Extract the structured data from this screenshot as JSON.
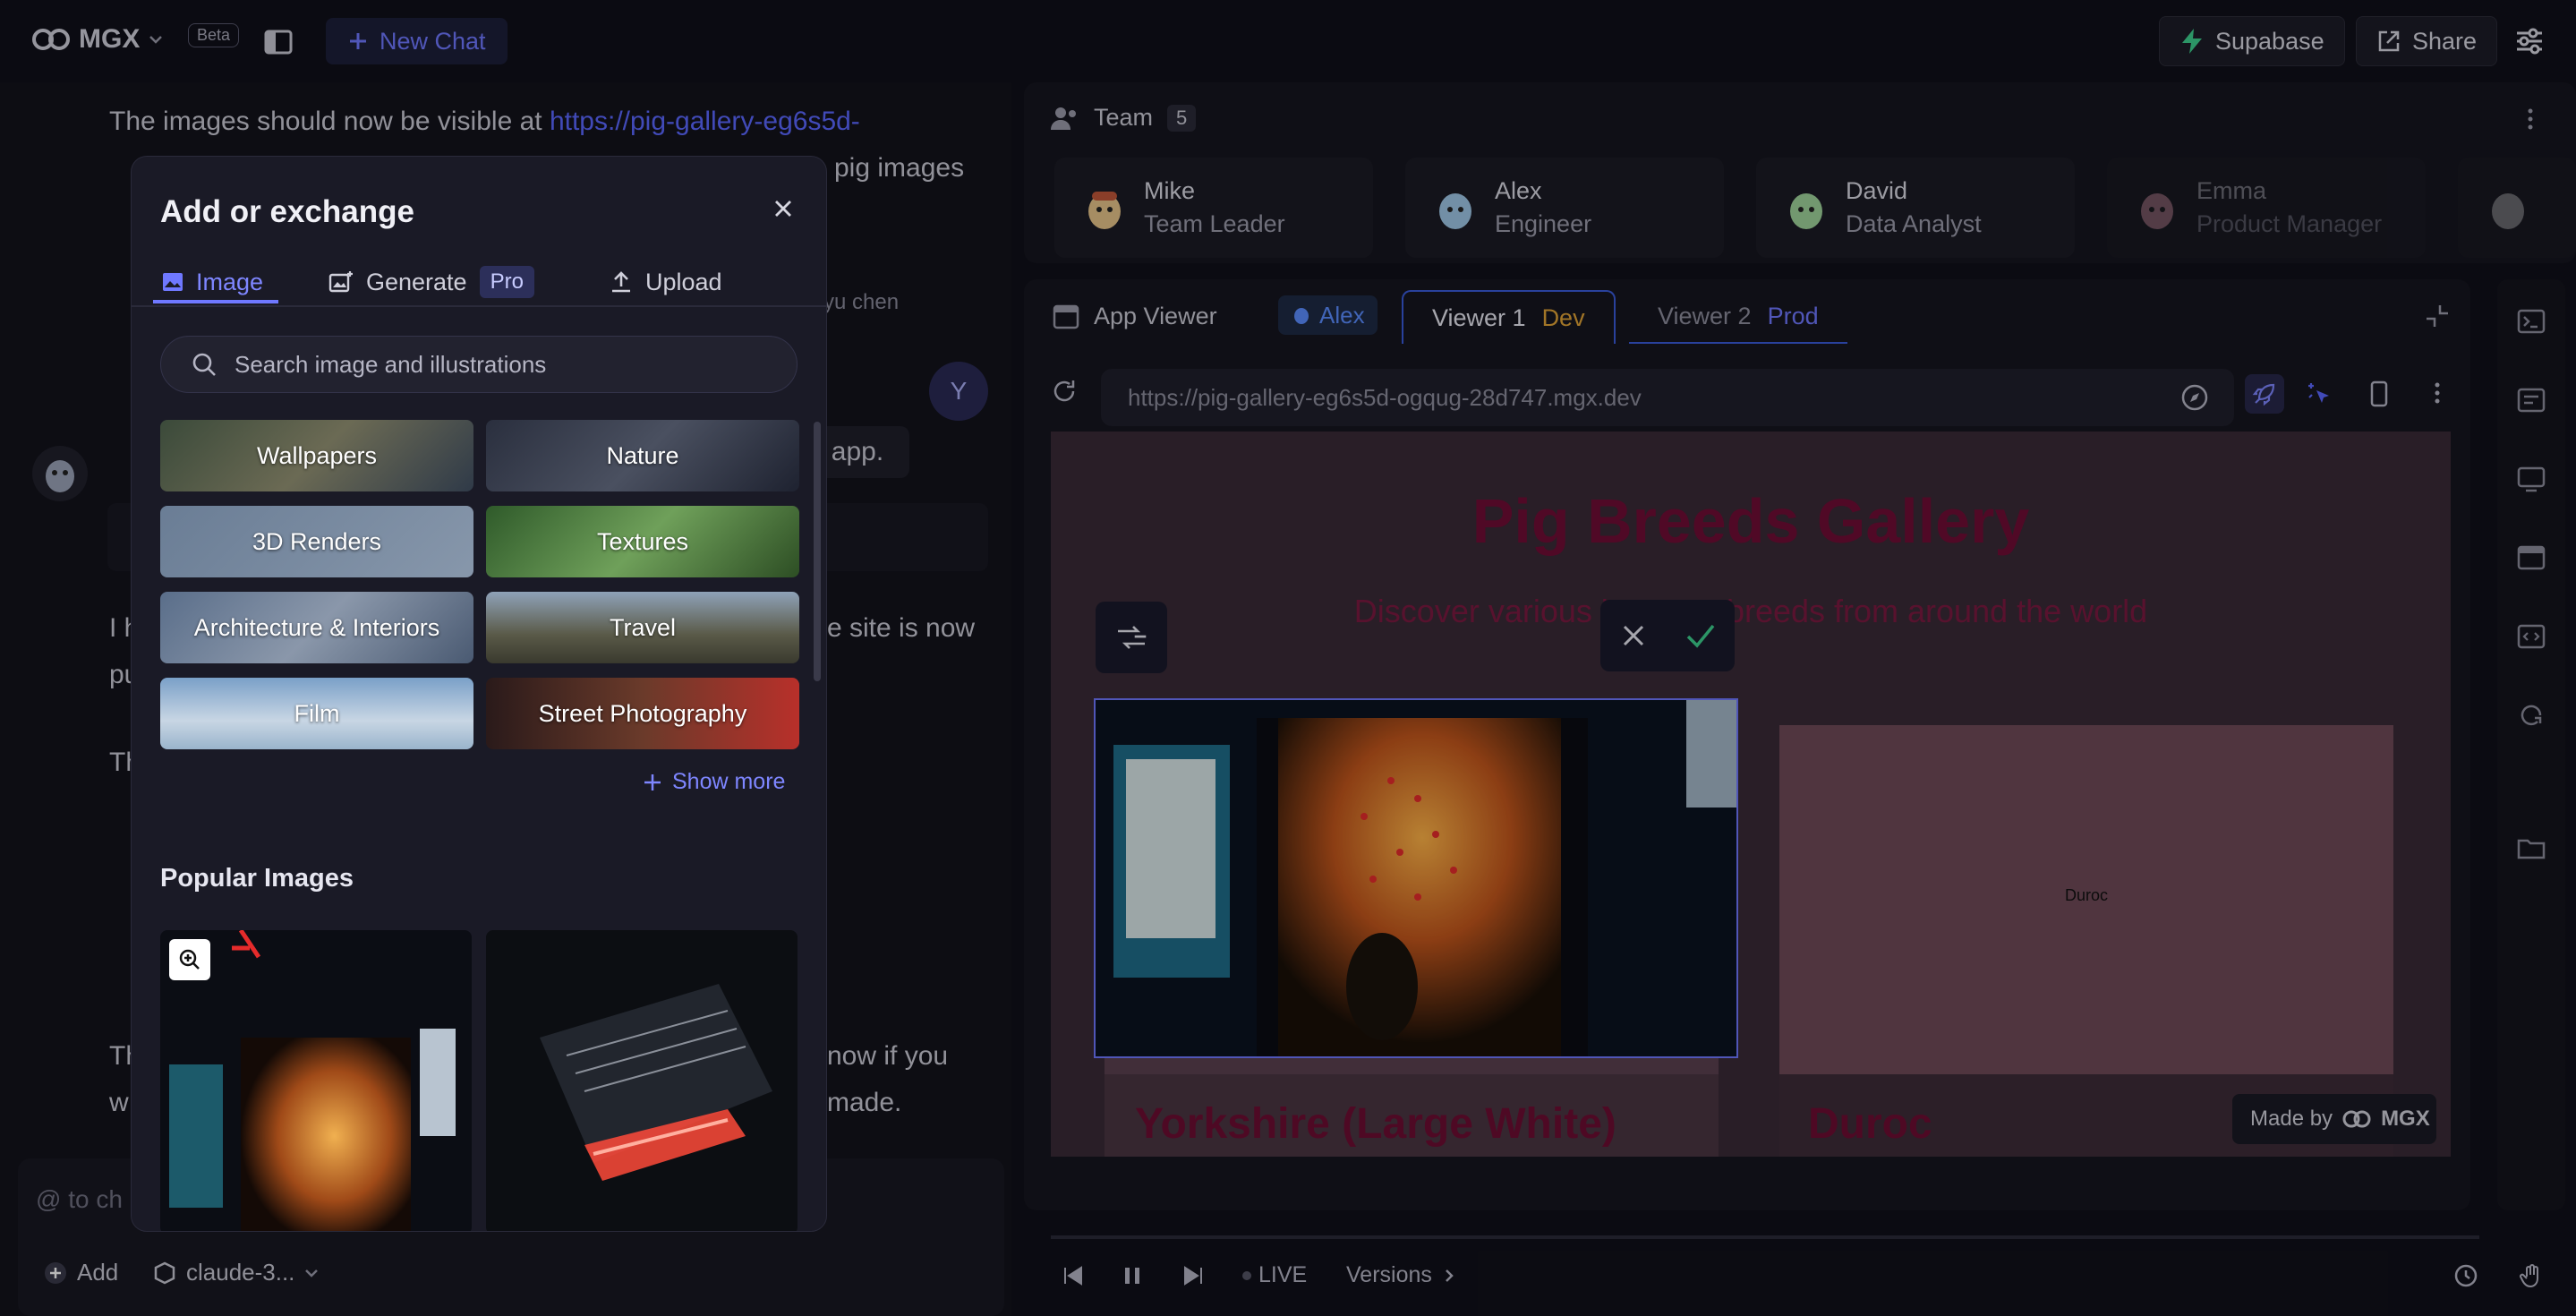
{
  "topbar": {
    "brand": "MGX",
    "beta": "Beta",
    "new_chat": "New Chat",
    "supabase": "Supabase",
    "share": "Share"
  },
  "chat": {
    "line1": "The images should now be visible at ",
    "link": "https://pig-gallery-eg6s5d-",
    "line2_tail": "pig images",
    "user_name": "yu chen",
    "user_avatar": "Y",
    "user_msg_tail": "app.",
    "line_left_3": "I h",
    "line_left_3b": "pu",
    "line_right_3": "e site is now",
    "line_left_4": "Th",
    "line_left_5": "Th",
    "line_left_5b": "w",
    "line_right_5": "now if you",
    "line_right_5b": "made.",
    "input_placeholder": "@ to ch",
    "add_label": "Add",
    "model": "claude-3..."
  },
  "team": {
    "title": "Team",
    "count": "5",
    "members": [
      {
        "name": "Mike",
        "role": "Team Leader"
      },
      {
        "name": "Alex",
        "role": "Engineer"
      },
      {
        "name": "David",
        "role": "Data Analyst"
      },
      {
        "name": "Emma",
        "role": "Product Manager"
      }
    ]
  },
  "viewer": {
    "title": "App Viewer",
    "agent": "Alex",
    "tab1": "Viewer 1",
    "tab1_env": "Dev",
    "tab2": "Viewer 2",
    "tab2_env": "Prod",
    "url": "https://pig-gallery-eg6s5d-ogqug-28d747.mgx.dev"
  },
  "preview": {
    "title": "Pig Breeds Gallery",
    "subtitle_left": "Discover various be",
    "subtitle_right": "g breeds from around the world",
    "card1_title": "Yorkshire (Large White)",
    "card2_label": "Duroc",
    "card2_title": "Duroc",
    "made_by": "Made by",
    "made_by_brand": "MGX"
  },
  "player": {
    "live": "LIVE",
    "versions": "Versions"
  },
  "modal": {
    "title": "Add or exchange",
    "tabs": {
      "image": "Image",
      "generate": "Generate",
      "pro": "Pro",
      "upload": "Upload"
    },
    "search_placeholder": "Search image and illustrations",
    "categories": [
      "Wallpapers",
      "Nature",
      "3D Renders",
      "Textures",
      "Architecture & Interiors",
      "Travel",
      "Film",
      "Street Photography"
    ],
    "show_more": "Show more",
    "popular_title": "Popular Images"
  },
  "colors": {
    "accent": "#5b67ff",
    "dev": "#e0a236",
    "prod": "#6f78ff",
    "pig_title": "#6f0d35"
  }
}
